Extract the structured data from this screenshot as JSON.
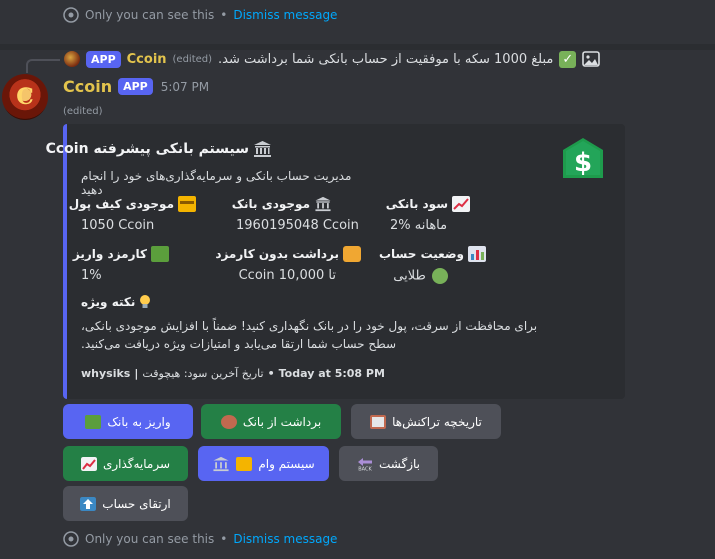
{
  "ephemeral_top": {
    "text": "Only you can see this",
    "separator": "•",
    "dismiss": "Dismiss message"
  },
  "reply": {
    "app_badge": "APP",
    "name": "Ccoin",
    "edited": "(edited)",
    "text": "مبلغ 1000 سکه با موفقیت از حساب بانکی شما برداشت شد."
  },
  "message": {
    "author": "Ccoin",
    "app_badge": "APP",
    "time": "5:07 PM",
    "edited": "(edited)",
    "avatar_letter": "C"
  },
  "embed": {
    "title": "سیستم بانکی پیشرفته Ccoin",
    "description": "مدیریت حساب بانکی و سرمایه‌گذاری‌های خود را انجام دهید",
    "fields": [
      {
        "name": "موجودی کیف پول",
        "value": "1050 Ccoin",
        "icon": "credit-card-icon"
      },
      {
        "name": "موجودی بانک",
        "value": "1960195048 Ccoin",
        "icon": "bank-icon"
      },
      {
        "name": "سود بانکی",
        "value": "2% ماهانه",
        "icon": "chart-up-icon"
      },
      {
        "name": "کارمزد واریز",
        "value": "1%",
        "icon": "money-wings-icon"
      },
      {
        "name": "برداشت بدون کارمزد",
        "value": "تا 10,000 Ccoin",
        "icon": "lock-key-icon"
      },
      {
        "name": "وضعیت حساب",
        "value": "طلایی",
        "icon": "bar-chart-icon"
      }
    ],
    "note_title": "نکته ویژه",
    "note_lines": [
      "برای محافظت از سرقت، پول خود را در بانک نگهداری کنید! ضمناً با افزایش موجودی بانکی،",
      "سطح حساب شما ارتقا می‌یابد و امتیازات ویژه دریافت می‌کنید."
    ],
    "footer_user": "whysiks",
    "footer_sep": "|",
    "footer_text": "تاریخ آخرین سود: هیچوقت",
    "footer_time": "Today at 5:08 PM",
    "accent_color": "#5865f2"
  },
  "buttons": [
    {
      "label": "واریز به بانک",
      "style": "blurple",
      "icon": "money-wings-icon"
    },
    {
      "label": "برداشت از بانک",
      "style": "green",
      "icon": "money-bag-icon"
    },
    {
      "label": "تاریخچه تراکنش‌ها",
      "style": "grey",
      "icon": "clipboard-icon"
    },
    {
      "label": "سرمایه‌گذاری",
      "style": "green",
      "icon": "chart-up-icon"
    },
    {
      "label": "سیستم وام",
      "style": "blurple",
      "icon": "bank-card-icon"
    },
    {
      "label": "بازگشت",
      "style": "grey",
      "icon": "back-arrow-icon"
    },
    {
      "label": "ارتقای حساب",
      "style": "grey",
      "icon": "up-arrow-icon"
    }
  ],
  "ephemeral_bottom": {
    "text": "Only you can see this",
    "separator": "•",
    "dismiss": "Dismiss message"
  }
}
